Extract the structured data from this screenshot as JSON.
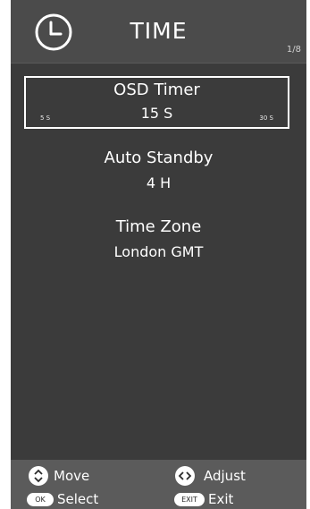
{
  "header": {
    "title": "TIME",
    "page": "1/8",
    "icon": "clock-icon"
  },
  "menu": {
    "selected": {
      "label": "OSD Timer",
      "value": "15 S",
      "min_label": "5 S",
      "max_label": "30 S"
    },
    "items": [
      {
        "label": "Auto Standby",
        "value": "4 H"
      },
      {
        "label": "Time Zone",
        "value": "London GMT"
      }
    ]
  },
  "footer": {
    "move": {
      "icon": "up-down-arrows-icon",
      "label": "Move"
    },
    "adjust": {
      "icon": "left-right-arrows-icon",
      "label": "Adjust"
    },
    "select": {
      "button": "OK",
      "label": "Select"
    },
    "exit": {
      "button": "EXIT",
      "label": "Exit"
    }
  },
  "colors": {
    "background": "#3b3b3b",
    "header": "#4b4b4b",
    "footer": "#5b5b5b",
    "text": "#ffffff"
  }
}
